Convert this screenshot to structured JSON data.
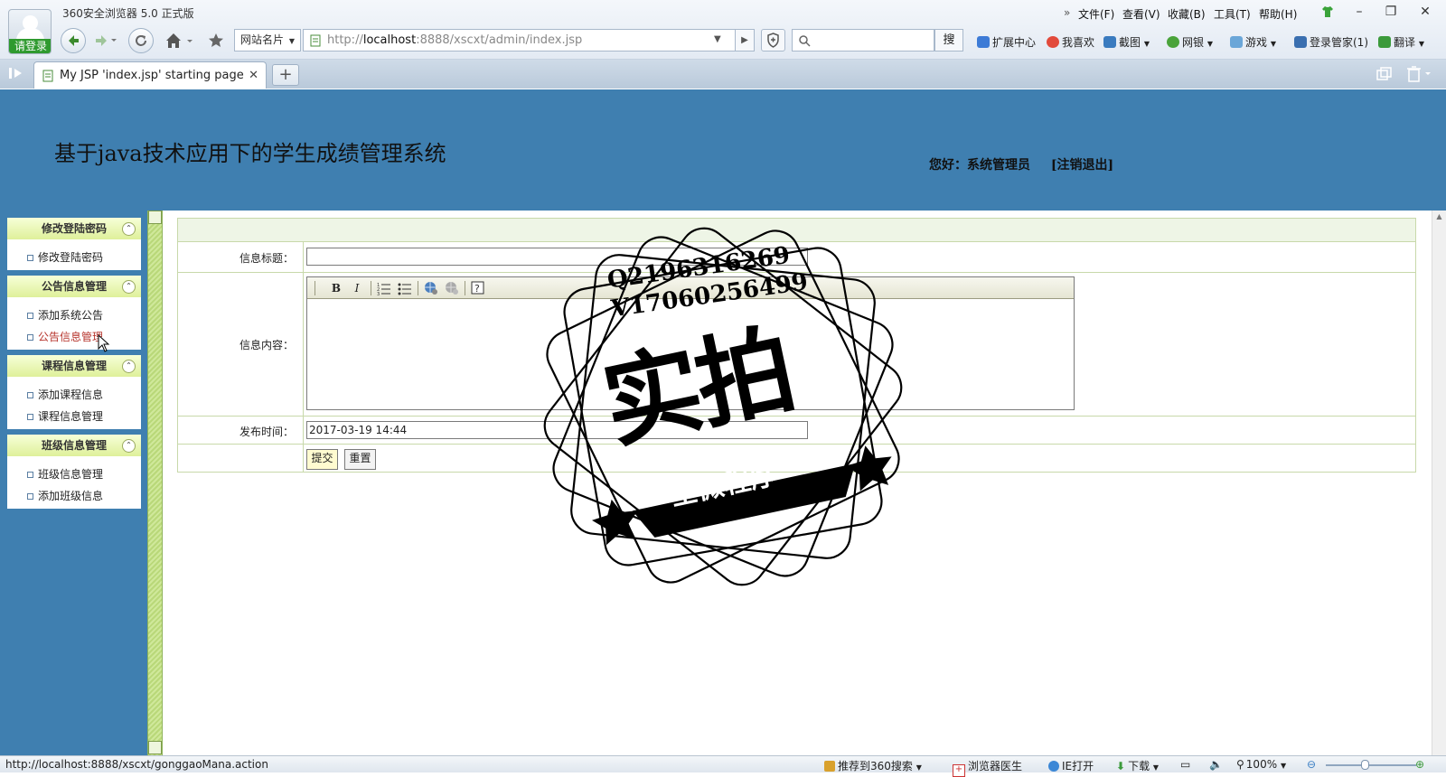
{
  "browser": {
    "app_title": "360安全浏览器 5.0 正式版",
    "login_label": "请登录",
    "menu": [
      "文件(F)",
      "查看(V)",
      "收藏(B)",
      "工具(T)",
      "帮助(H)"
    ],
    "menu_overflow": "»",
    "site_dropdown": "网站名片",
    "url_prefix": "http://",
    "url_host": "localhost",
    "url_path": ":8888/xscxt/admin/index.jsp",
    "search_button": "搜",
    "toolbar_items": [
      "扩展中心",
      "我喜欢",
      "截图",
      "网银",
      "游戏",
      "登录管家(1)",
      "翻译"
    ],
    "tab_title": "My JSP 'index.jsp' starting page",
    "new_tab": "+",
    "window_buttons": [
      "–",
      "❐",
      "✕"
    ]
  },
  "header": {
    "system_title": "基于java技术应用下的学生成绩管理系统",
    "greeting": "您好：系统管理员",
    "logout": "[注销退出]"
  },
  "sidebar": {
    "groups": [
      {
        "title": "修改登陆密码",
        "items": [
          "修改登陆密码"
        ]
      },
      {
        "title": "公告信息管理",
        "items": [
          "添加系统公告",
          "公告信息管理"
        ]
      },
      {
        "title": "课程信息管理",
        "items": [
          "添加课程信息",
          "课程信息管理"
        ]
      },
      {
        "title": "班级信息管理",
        "items": [
          "班级信息管理",
          "添加班级信息"
        ]
      }
    ],
    "active_item": "公告信息管理"
  },
  "form": {
    "title_label": "信息标题：",
    "title_value": "",
    "content_label": "信息内容：",
    "date_label": "发布时间：",
    "date_value": "2017-03-19 14:44",
    "submit_label": "提交",
    "reset_label": "重置"
  },
  "editor_toolbar": [
    "B",
    "I",
    "ordered-list",
    "unordered-list",
    "link",
    "unlink",
    "help"
  ],
  "watermark": {
    "line1": "Q2196316269",
    "line2": "V17060256499",
    "main": "实拍",
    "ribbon": "全微程序"
  },
  "statusbar": {
    "url": "http://localhost:8888/xscxt/gonggaoMana.action",
    "items": [
      "推荐到360搜索",
      "浏览器医生",
      "IE打开",
      "下载"
    ],
    "zoom": "100%"
  },
  "colors": {
    "header_bg": "#3f7fb0",
    "sidebar_head": "#dff09a",
    "active_link": "#b7352d",
    "form_border": "#c8d9aa"
  }
}
